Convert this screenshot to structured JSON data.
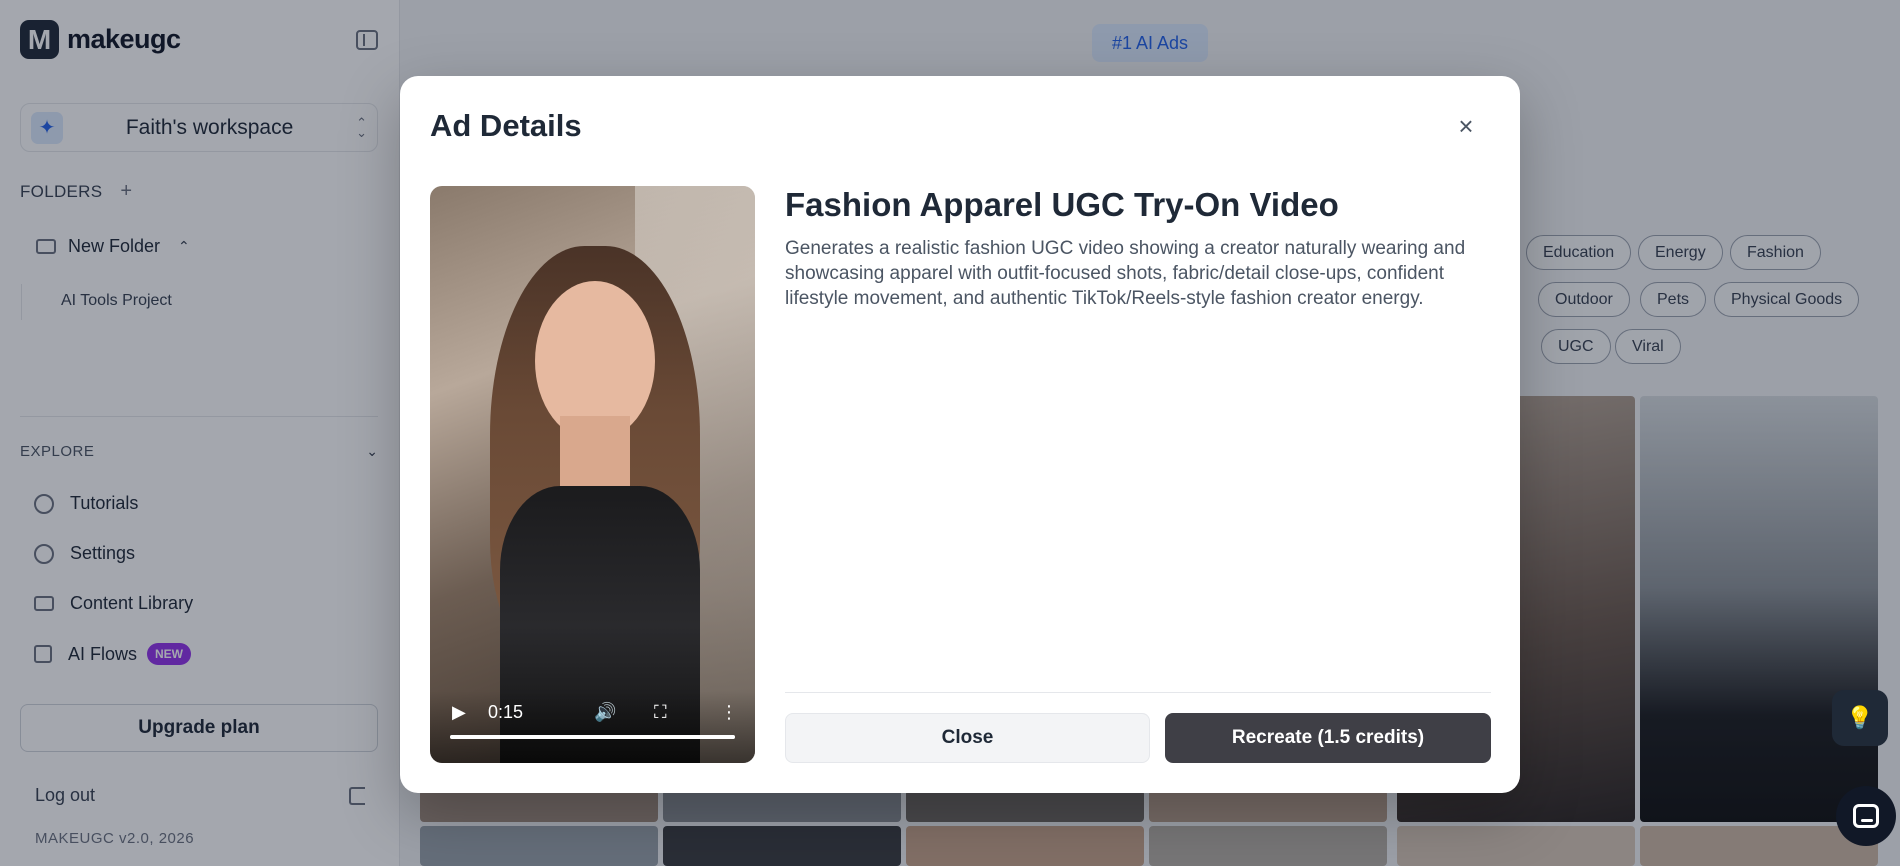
{
  "sidebar": {
    "logo_letter": "M",
    "logo_text": "makeugc",
    "workspace_icon": "✦",
    "workspace_name": "Faith's workspace",
    "folders_label": "FOLDERS",
    "folders_add": "+",
    "folder": {
      "name": "New Folder",
      "sub_items": [
        "AI Tools Project"
      ]
    },
    "explore_label": "EXPLORE",
    "nav": [
      {
        "label": "Tutorials",
        "icon": "play-circle-icon"
      },
      {
        "label": "Settings",
        "icon": "gear-icon"
      },
      {
        "label": "Content Library",
        "icon": "folder-icon"
      },
      {
        "label": "AI Flows",
        "icon": "flow-icon",
        "badge": "NEW"
      }
    ],
    "upgrade_label": "Upgrade plan",
    "logout_label": "Log out",
    "version": "MAKEUGC v2.0, 2026"
  },
  "main": {
    "top_pill": "#1 AI Ads",
    "tags": [
      "Education",
      "Energy",
      "Fashion",
      "Outdoor",
      "Pets",
      "Physical Goods",
      "UGC",
      "Viral"
    ]
  },
  "modal": {
    "title": "Ad Details",
    "close_icon": "×",
    "video": {
      "time": "0:15",
      "progress": 1.0
    },
    "ad_title": "Fashion Apparel UGC Try-On Video",
    "ad_description": "Generates a realistic fashion UGC video showing a creator naturally wearing and showcasing apparel with outfit-focused shots, fabric/detail close-ups, confident lifestyle movement, and authentic TikTok/Reels-style fashion creator energy.",
    "close_button": "Close",
    "recreate_button": "Recreate (1.5 credits)"
  },
  "colors": {
    "accent_blue": "#2563eb",
    "badge_purple": "#9333ea",
    "primary_button": "#3f3f46"
  }
}
